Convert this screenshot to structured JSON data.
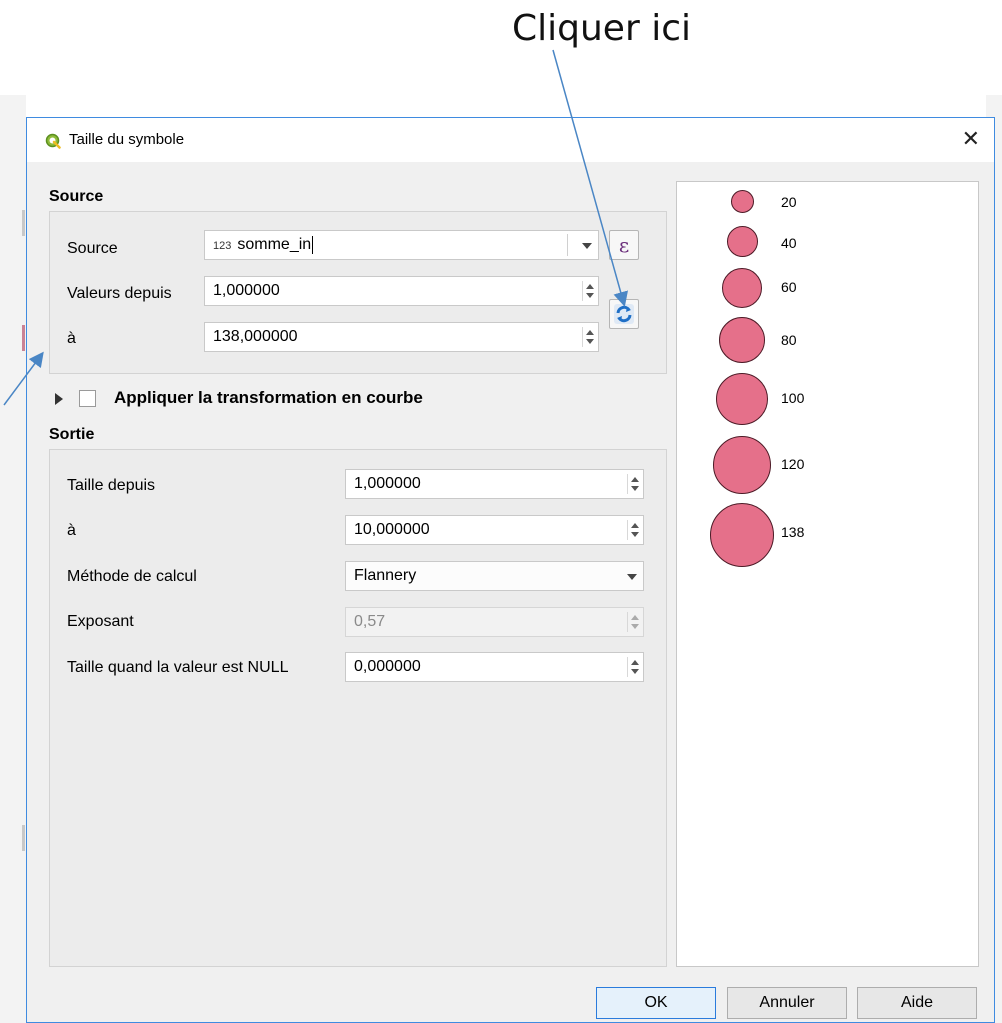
{
  "annotation": {
    "text": "Cliquer ici"
  },
  "dialog": {
    "title": "Taille du symbole",
    "close_glyph": "✕",
    "source_section": {
      "heading": "Source",
      "source_label": "Source",
      "source_field": {
        "type_badge": "123",
        "value": "somme_in"
      },
      "expression_glyph": "ε",
      "valeurs_label": "Valeurs depuis",
      "valeurs_value": "1,000000",
      "a_label": "à",
      "a_value": "138,000000",
      "refresh_icon": "refresh-icon"
    },
    "curve": {
      "label": "Appliquer la transformation en courbe",
      "checked": false,
      "expanded": false
    },
    "output_section": {
      "heading": "Sortie",
      "taille_depuis_label": "Taille depuis",
      "taille_depuis_value": "1,000000",
      "a_label": "à",
      "a_value": "10,000000",
      "methode_label": "Méthode de calcul",
      "methode_value": "Flannery",
      "exposant_label": "Exposant",
      "exposant_value": "0,57",
      "null_label": "Taille quand la valeur est NULL",
      "null_value": "0,000000"
    },
    "legend": {
      "fill_color": "#e5708a",
      "stroke_color": "#4c1a26",
      "items": [
        {
          "label": "20"
        },
        {
          "label": "40"
        },
        {
          "label": "60"
        },
        {
          "label": "80"
        },
        {
          "label": "100"
        },
        {
          "label": "120"
        },
        {
          "label": "138"
        }
      ]
    },
    "buttons": {
      "ok": "OK",
      "cancel": "Annuler",
      "help": "Aide"
    }
  },
  "colors": {
    "accent": "#3f8be0",
    "arrow": "#4a86c5"
  }
}
